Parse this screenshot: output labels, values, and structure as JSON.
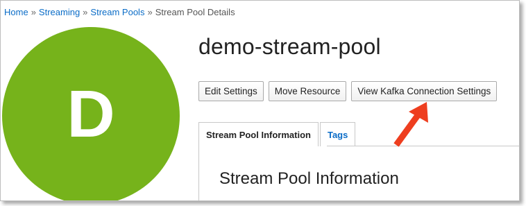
{
  "breadcrumb": {
    "items": [
      {
        "label": "Home"
      },
      {
        "label": "Streaming"
      },
      {
        "label": "Stream Pools"
      }
    ],
    "separator": "»",
    "current": "Stream Pool Details"
  },
  "avatar": {
    "letter": "D",
    "color": "#76b31b"
  },
  "header": {
    "title": "demo-stream-pool"
  },
  "actions": {
    "edit_label": "Edit Settings",
    "move_label": "Move Resource",
    "kafka_label": "View Kafka Connection Settings"
  },
  "tabs": [
    {
      "label": "Stream Pool Information",
      "active": true
    },
    {
      "label": "Tags",
      "active": false
    }
  ],
  "panel": {
    "title": "Stream Pool Information"
  },
  "annotation": {
    "arrow_color": "#ee3e1f",
    "arrow_icon": "red-arrow-icon"
  },
  "colors": {
    "link": "#0a6cc7",
    "text": "#222222"
  }
}
